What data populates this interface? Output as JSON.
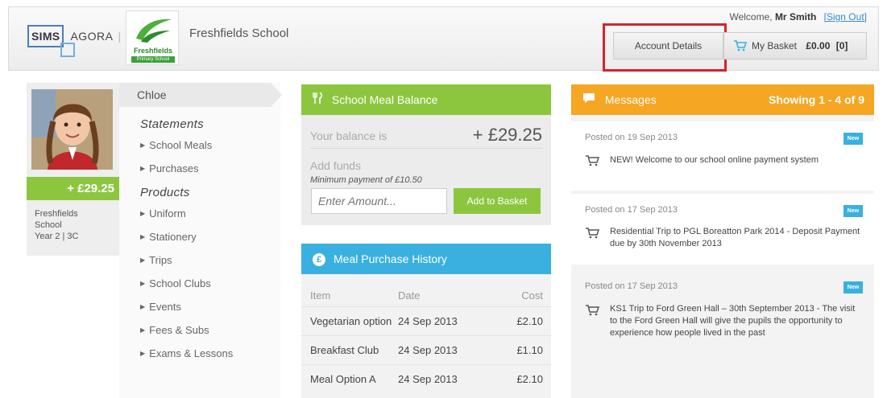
{
  "header": {
    "product_name_left": "SIMS",
    "product_name_right": "AGORA",
    "separator": "|",
    "school_crest_name": "Freshfields",
    "school_crest_subtitle": "Primary School",
    "school_name": "Freshfields School",
    "welcome_prefix": "Welcome,",
    "user_name": "Mr Smith",
    "sign_out_label": "[Sign Out]",
    "account_details_label": "Account Details",
    "basket_label": "My Basket",
    "basket_total": "£0.00",
    "basket_count": "[0]"
  },
  "pupil": {
    "balance": "+ £29.25",
    "school_line1": "Freshfields",
    "school_line2": "School",
    "class": "Year 2 | 3C"
  },
  "nav": {
    "pupil_name": "Chloe",
    "statements_heading": "Statements",
    "statements": [
      "School Meals",
      "Purchases"
    ],
    "products_heading": "Products",
    "products": [
      "Uniform",
      "Stationery",
      "Trips",
      "School Clubs",
      "Events",
      "Fees & Subs",
      "Exams & Lessons"
    ]
  },
  "meal_balance": {
    "title": "School Meal Balance",
    "balance_label": "Your balance is",
    "balance_value": "+ £29.25",
    "add_funds_label": "Add funds",
    "min_payment": "Minimum payment of £10.50",
    "amount_placeholder": "Enter Amount...",
    "add_button": "Add to Basket"
  },
  "meal_history": {
    "title": "Meal Purchase History",
    "columns": [
      "Item",
      "Date",
      "Cost"
    ],
    "rows": [
      [
        "Vegetarian option",
        "24 Sep 2013",
        "£2.10"
      ],
      [
        "Breakfast Club",
        "24 Sep 2013",
        "£1.10"
      ],
      [
        "Meal Option A",
        "24 Sep 2013",
        "£2.10"
      ]
    ]
  },
  "messages": {
    "title": "Messages",
    "showing": "Showing 1 - 4 of 9",
    "new_badge": "New",
    "items": [
      {
        "date": "Posted on 19 Sep 2013",
        "text": "NEW! Welcome to our school online payment system"
      },
      {
        "date": "Posted on 17 Sep 2013",
        "text": "Residential Trip to PGL Boreatton Park 2014 - Deposit Payment due by 30th November 2013"
      },
      {
        "date": "Posted on 17 Sep 2013",
        "text": "KS1 Trip to Ford Green Hall – 30th September 2013 - The visit to the Ford Green Hall will give the pupils the opportunity to experience how people lived in the past"
      }
    ]
  },
  "colors": {
    "green": "#8cc63f",
    "blue": "#3ab0e0",
    "orange": "#f5a623",
    "highlight_red": "#d6232b"
  }
}
